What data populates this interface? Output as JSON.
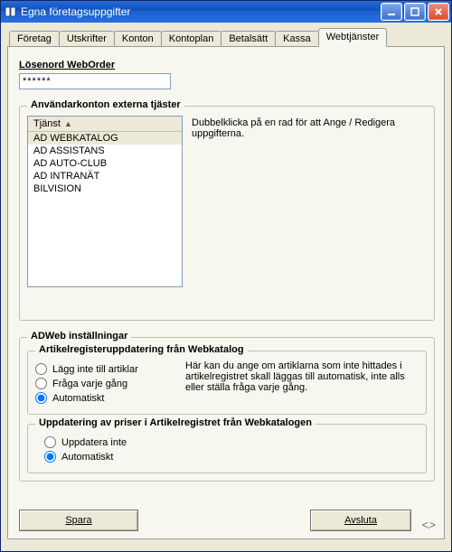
{
  "window": {
    "title": "Egna företagsuppgifter"
  },
  "tabs": [
    {
      "label": "Företag"
    },
    {
      "label": "Utskrifter"
    },
    {
      "label": "Konton"
    },
    {
      "label": "Kontoplan"
    },
    {
      "label": "Betalsätt"
    },
    {
      "label": "Kassa"
    },
    {
      "label": "Webtjänster"
    }
  ],
  "password": {
    "label": "Lösenord WebOrder",
    "value_mask": "******"
  },
  "external_accounts": {
    "legend": "Användarkonton externa tjäster",
    "list_header": "Tjänst",
    "items": [
      "AD WEBKATALOG",
      "AD ASSISTANS",
      "AD AUTO-CLUB",
      "AD INTRANÄT",
      "BILVISION"
    ],
    "hint": "Dubbelklicka på en rad för att Ange / Redigera uppgifterna."
  },
  "adweb": {
    "legend": "ADWeb inställningar",
    "article_update": {
      "legend": "Artikelregisteruppdatering från Webkatalog",
      "options": {
        "none": "Lägg inte till artiklar",
        "ask": "Fråga varje gång",
        "auto": "Automatiskt"
      },
      "selected": "auto",
      "explain": "Här kan du ange om artiklarna som inte hittades i artikelregistret skall läggas till automatisk, inte alls eller ställa fråga varje gång."
    },
    "price_update": {
      "legend": "Uppdatering av priser i Artikelregistret från Webkatalogen",
      "options": {
        "none": "Uppdatera inte",
        "auto": "Automatiskt"
      },
      "selected": "auto"
    }
  },
  "buttons": {
    "save": "Spara",
    "close": "Avsluta"
  }
}
